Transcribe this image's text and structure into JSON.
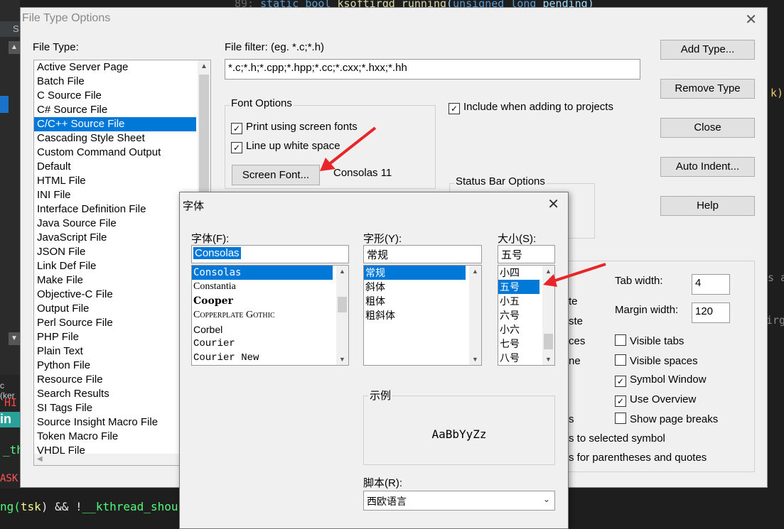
{
  "ide": {
    "tab_label": "S",
    "code_top": {
      "line": "89:",
      "kw1": "static",
      "ty": "bool",
      "fn": "ksoftirqd_running",
      "p1": "(",
      "ty2": "unsigned long",
      "p2": "pending)"
    },
    "code_right1": "k);",
    "code_right2": "s a",
    "code_right3": "irg",
    "side_text1": "c (ker",
    "side_text2": "HI",
    "side_text3": "in",
    "side_text4": "_th",
    "side_text5": "ASK",
    "code_bottom": {
      "a": "ng(",
      "b": "tsk",
      "c": ") && !",
      "d": "__kthread_shou"
    }
  },
  "dialog": {
    "title": "File Type Options",
    "file_type_label": "File Type:",
    "file_types": [
      "Active Server Page",
      "Batch File",
      "C Source File",
      "C# Source File",
      "C/C++ Source File",
      "Cascading Style Sheet",
      "Custom Command Output",
      "Default",
      "HTML File",
      "INI File",
      "Interface Definition File",
      "Java Source File",
      "JavaScript File",
      "JSON File",
      "Link Def File",
      "Make File",
      "Objective-C File",
      "Output File",
      "Perl Source File",
      "PHP File",
      "Plain Text",
      "Python File",
      "Resource File",
      "Search Results",
      "SI Tags File",
      "Source Insight Macro File",
      "Token Macro File",
      "VHDL File"
    ],
    "selected_file_type": "C/C++ Source File",
    "file_filter_label": "File filter: (eg. *.c;*.h)",
    "file_filter_value": "*.c;*.h;*.cpp;*.hpp;*.cc;*.cxx;*.hxx;*.hh",
    "font_options": {
      "title": "Font Options",
      "print_screen_fonts": "Print using screen fonts",
      "line_up_white_space": "Line up white space",
      "screen_font_button": "Screen Font...",
      "current_font": "Consolas 11"
    },
    "include_projects": "Include when adding to projects",
    "status_bar_options": "Status Bar Options",
    "buttons": {
      "add_type": "Add Type...",
      "remove_type": "Remove Type",
      "close": "Close",
      "auto_indent": "Auto Indent...",
      "help": "Help"
    },
    "tab_width_label": "Tab width:",
    "tab_width_value": "4",
    "margin_width_label": "Margin width:",
    "margin_width_value": "120",
    "options_right": [
      {
        "label": "Visible tabs",
        "checked": false
      },
      {
        "label": "Visible spaces",
        "checked": false
      },
      {
        "label": "Symbol Window",
        "checked": true
      },
      {
        "label": "Use Overview",
        "checked": true
      },
      {
        "label": "Show page breaks",
        "checked": false
      }
    ],
    "partial_left": [
      "te",
      "ste",
      "ces",
      "ne",
      "s"
    ],
    "highlight_symbol": "s to selected symbol",
    "highlight_parens": "s for parentheses and quotes"
  },
  "font_dialog": {
    "title": "字体",
    "font_label": "字体(F):",
    "font_value": "Consolas",
    "fonts": [
      "Consolas",
      "Constantia",
      "Cooper",
      "Copperplate Gothic",
      "Corbel",
      "Courier",
      "Courier New"
    ],
    "style_label": "字形(Y):",
    "style_value": "常规",
    "styles": [
      "常规",
      "斜体",
      "粗体",
      "粗斜体"
    ],
    "size_label": "大小(S):",
    "size_value": "五号",
    "sizes": [
      "小四",
      "五号",
      "小五",
      "六号",
      "小六",
      "七号",
      "八号"
    ],
    "sample_label": "示例",
    "sample_text": "AaBbYyZz",
    "script_label": "脚本(R):",
    "script_value": "西欧语言"
  },
  "colors": {
    "selection": "#0078d7",
    "annotation_arrow": "#e8262a"
  }
}
